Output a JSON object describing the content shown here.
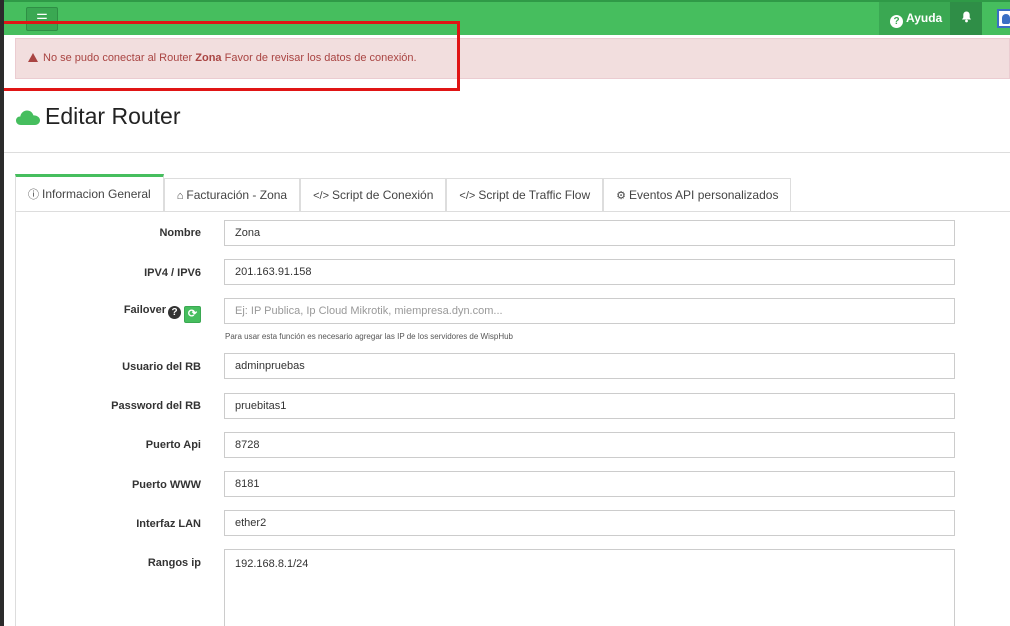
{
  "topbar": {
    "menu_icon": "bars-icon",
    "help_label": "Ayuda",
    "bell_icon": "bell-icon"
  },
  "alert": {
    "prefix": "No se pudo conectar al Router",
    "router_name": "Zona",
    "suffix": "Favor de revisar los datos de conexión."
  },
  "page": {
    "title": "Editar Router"
  },
  "tabs": [
    {
      "label": "Informacion General",
      "icon": "info-icon"
    },
    {
      "label": "Facturación - Zona",
      "icon": "home-icon"
    },
    {
      "label": "Script de Conexión",
      "icon": "code-icon"
    },
    {
      "label": "Script de Traffic Flow",
      "icon": "code-icon"
    },
    {
      "label": "Eventos API personalizados",
      "icon": "gear-icon"
    }
  ],
  "form": {
    "nombre": {
      "label": "Nombre",
      "value": "Zona"
    },
    "ip": {
      "label": "IPV4 / IPV6",
      "value": "201.163.91.158"
    },
    "failover": {
      "label": "Failover",
      "placeholder": "Ej: IP Publica, Ip Cloud Mikrotik, miempresa.dyn.com...",
      "help": "Para usar esta función es necesario agregar las IP de los servidores de WispHub"
    },
    "usuario": {
      "label": "Usuario del RB",
      "value": "adminpruebas"
    },
    "password": {
      "label": "Password del RB",
      "value": "pruebitas1"
    },
    "puerto_api": {
      "label": "Puerto Api",
      "value": "8728"
    },
    "puerto_www": {
      "label": "Puerto WWW",
      "value": "8181"
    },
    "interfaz": {
      "label": "Interfaz LAN",
      "value": "ether2"
    },
    "rangos": {
      "label": "Rangos ip",
      "value": "192.168.8.1/24"
    }
  },
  "colors": {
    "brand_green": "#46be5e",
    "alert_bg": "#f2dede",
    "alert_text": "#a94442",
    "annotation_red": "#e01515"
  }
}
